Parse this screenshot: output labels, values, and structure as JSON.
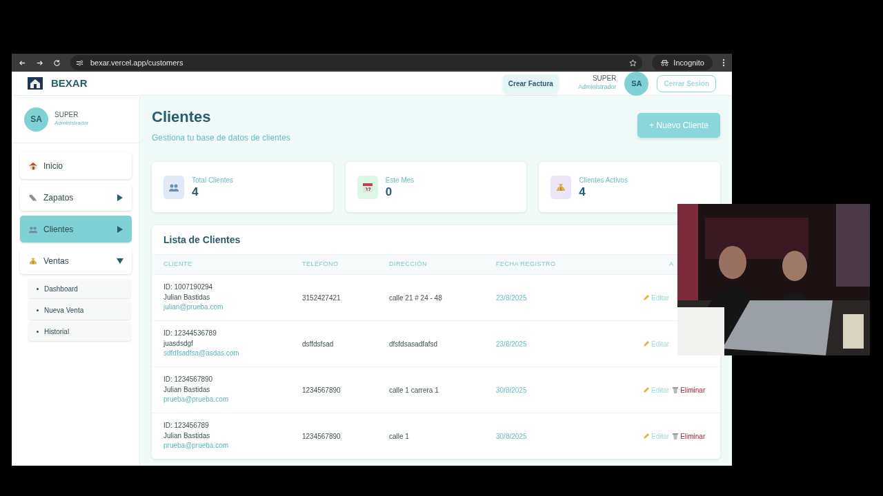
{
  "browser": {
    "url": "bexar.vercel.app/customers",
    "incognito": "Incognito"
  },
  "header": {
    "brand": "BEXAR",
    "create_invoice": "Crear Factura",
    "user_name": "SUPER",
    "user_role": "Administrador",
    "initials": "SA",
    "logout": "Cerrar Sesión"
  },
  "sidebar": {
    "profile": {
      "initials": "SA",
      "name": "SUPER",
      "role": "Administrador"
    },
    "items": [
      {
        "label": "Inicio",
        "selected": false
      },
      {
        "label": "Zapatos",
        "selected": false,
        "expanded": false
      },
      {
        "label": "Clientes",
        "selected": true,
        "expanded": false
      },
      {
        "label": "Ventas",
        "selected": false,
        "expanded": true,
        "children": [
          {
            "label": "Dashboard"
          },
          {
            "label": "Nueva Venta"
          },
          {
            "label": "Historial"
          }
        ]
      }
    ]
  },
  "page": {
    "title": "Clientes",
    "subtitle": "Gestiona tu base de datos de clientes",
    "new_button": "+ Nuevo Cliente"
  },
  "stats": [
    {
      "label": "Total Clientes",
      "value": "4"
    },
    {
      "label": "Este Mes",
      "value": "0"
    },
    {
      "label": "Clientes Activos",
      "value": "4"
    }
  ],
  "clients": {
    "title": "Lista de Clientes",
    "columns": [
      "CLIENTE",
      "TELÉFONO",
      "DIRECCIÓN",
      "FECHA REGISTRO",
      "A"
    ],
    "rows": [
      {
        "id": "ID: 1007190294",
        "name": "Julian Bastidas",
        "email": "julian@prueba.com",
        "phone": "3152427421",
        "address": "calle 21 # 24 - 48",
        "date": "23/8/2025",
        "edit": "Editar"
      },
      {
        "id": "ID: 12344536789",
        "name": "juasdsdgf",
        "email": "sdfdfsadfsa@asdas.com",
        "phone": "dsffdsfsad",
        "address": "dfsfdsasadfafsd",
        "date": "23/8/2025",
        "edit": "Editar"
      },
      {
        "id": "ID: 1234567890",
        "name": "Julian Bastidas",
        "email": "prueba@prueba.com",
        "phone": "1234567890",
        "address": "calle 1 carrera 1",
        "date": "30/8/2025",
        "edit": "Editar",
        "delete": "Eliminar"
      },
      {
        "id": "ID: 123456789",
        "name": "Julian Bastidas",
        "email": "prueba@prueba.com",
        "phone": "1234567890",
        "address": "calle 1",
        "date": "30/8/2025",
        "edit": "Editar",
        "delete": "Eliminar"
      }
    ]
  }
}
